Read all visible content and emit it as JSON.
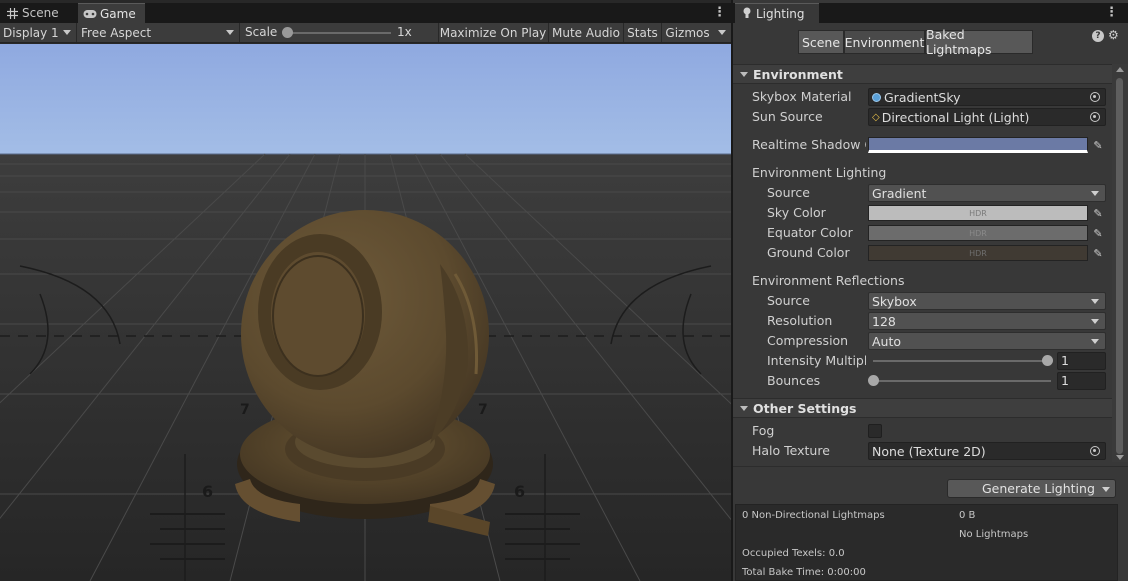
{
  "game_window": {
    "tabs": [
      {
        "label": "Scene",
        "icon": "grid-icon"
      },
      {
        "label": "Game",
        "icon": "gamepad-icon"
      }
    ],
    "toolbar": {
      "display": "Display 1",
      "aspect": "Free Aspect",
      "scale_label": "Scale",
      "scale_value": "1x",
      "buttons": [
        "Maximize On Play",
        "Mute Audio",
        "Stats",
        "Gizmos"
      ]
    },
    "viewport": {
      "grid_numbers": [
        "7",
        "7",
        "6",
        "6"
      ],
      "sky_top": "#8fa9e0",
      "sky_bottom": "#a3bde6",
      "ground": "#2c2c2c",
      "material_color": "#5c4a2e"
    }
  },
  "lighting_window": {
    "tab_title": "Lighting",
    "segments": [
      "Scene",
      "Environment",
      "Baked Lightmaps"
    ],
    "active_segment": "Environment",
    "environment_section": {
      "title": "Environment",
      "skybox_material": {
        "label": "Skybox Material",
        "value": "GradientSky"
      },
      "sun_source": {
        "label": "Sun Source",
        "value": "Directional Light (Light)"
      },
      "realtime_shadow_color": {
        "label": "Realtime Shadow Cc",
        "color": "#6b7aa5"
      },
      "environment_lighting": {
        "title": "Environment Lighting",
        "source": {
          "label": "Source",
          "value": "Gradient"
        },
        "sky_color": {
          "label": "Sky Color",
          "hdr": "HDR",
          "color": "#bcbcbc"
        },
        "equator_color": {
          "label": "Equator Color",
          "hdr": "HDR",
          "color": "#6c6c6c"
        },
        "ground_color": {
          "label": "Ground Color",
          "hdr": "HDR",
          "color": "#403a33"
        }
      },
      "environment_reflections": {
        "title": "Environment Reflections",
        "source": {
          "label": "Source",
          "value": "Skybox"
        },
        "resolution": {
          "label": "Resolution",
          "value": "128"
        },
        "compression": {
          "label": "Compression",
          "value": "Auto"
        },
        "intensity_multiplier": {
          "label": "Intensity Multiplie",
          "value": "1",
          "fraction": 1.0
        },
        "bounces": {
          "label": "Bounces",
          "value": "1",
          "fraction": 0.0
        }
      }
    },
    "other_settings_section": {
      "title": "Other Settings",
      "fog": {
        "label": "Fog",
        "checked": false
      },
      "halo_texture": {
        "label": "Halo Texture",
        "value": "None (Texture 2D)"
      }
    },
    "generate_button": "Generate Lighting",
    "stats": {
      "lightmaps": "0 Non-Directional Lightmaps",
      "size": "0 B",
      "no_lightmaps": "No Lightmaps",
      "occupied_texels": "Occupied Texels: 0.0",
      "total_bake_time": "Total Bake Time: 0:00:00"
    }
  }
}
